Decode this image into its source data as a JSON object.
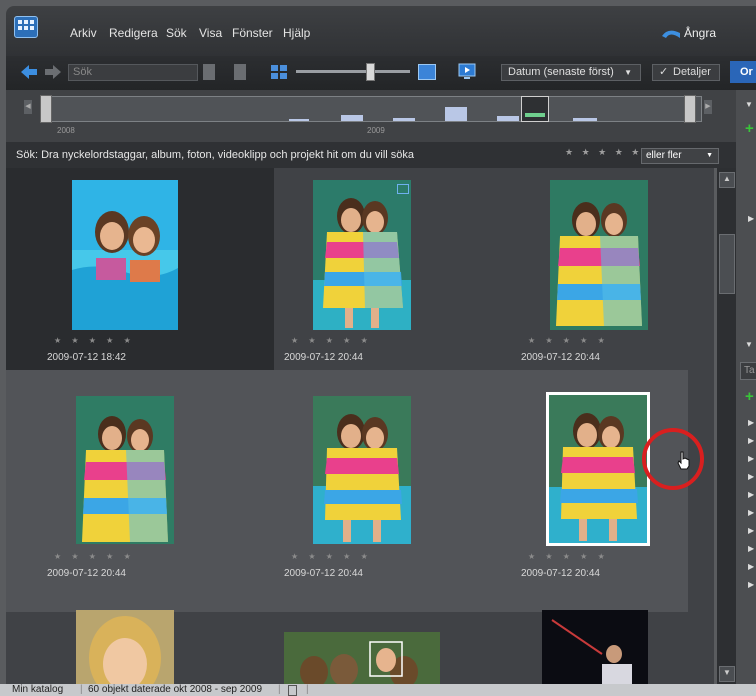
{
  "menu": {
    "items": [
      "Arkiv",
      "Redigera",
      "Sök",
      "Visa",
      "Fönster",
      "Hjälp"
    ],
    "undo_label": "Ångra"
  },
  "toolbar": {
    "search_placeholder": "Sök",
    "sort_selected": "Datum (senaste först)",
    "details_label": "Detaljer",
    "blue_button_label": "Or"
  },
  "timeline": {
    "years": [
      "2008",
      "2009"
    ]
  },
  "filter": {
    "prompt": "Sök: Dra nyckelordstaggar, album, foton, videoklipp och projekt hit om du vill söka",
    "stars": "★ ★ ★ ★ ★",
    "rating_option": "eller fler"
  },
  "grid": {
    "stars": "★ ★ ★ ★ ★",
    "items": [
      {
        "date": "2009-07-12 18:42"
      },
      {
        "date": "2009-07-12 20:44"
      },
      {
        "date": "2009-07-12 20:44"
      },
      {
        "date": "2009-07-12 20:44"
      },
      {
        "date": "2009-07-12 20:44"
      },
      {
        "date": "2009-07-12 20:44"
      }
    ]
  },
  "right_panel": {
    "search_placeholder": "Ta"
  },
  "status": {
    "catalog": "Min katalog",
    "count_text": "60 objekt daterade okt 2008 - sep 2009"
  },
  "colors": {
    "accent_blue": "#2a66b8",
    "add_green": "#39c539",
    "highlight_circle": "#d91f1f"
  }
}
